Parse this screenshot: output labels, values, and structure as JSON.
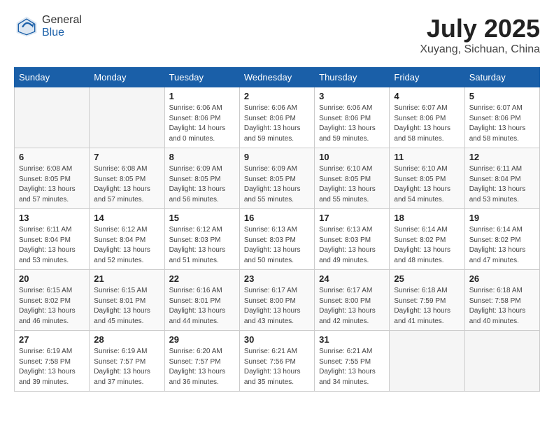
{
  "header": {
    "logo_general": "General",
    "logo_blue": "Blue",
    "month_year": "July 2025",
    "location": "Xuyang, Sichuan, China"
  },
  "days_of_week": [
    "Sunday",
    "Monday",
    "Tuesday",
    "Wednesday",
    "Thursday",
    "Friday",
    "Saturday"
  ],
  "weeks": [
    [
      {
        "day": "",
        "sunrise": "",
        "sunset": "",
        "daylight": "",
        "empty": true
      },
      {
        "day": "",
        "sunrise": "",
        "sunset": "",
        "daylight": "",
        "empty": true
      },
      {
        "day": "1",
        "sunrise": "Sunrise: 6:06 AM",
        "sunset": "Sunset: 8:06 PM",
        "daylight": "Daylight: 14 hours and 0 minutes."
      },
      {
        "day": "2",
        "sunrise": "Sunrise: 6:06 AM",
        "sunset": "Sunset: 8:06 PM",
        "daylight": "Daylight: 13 hours and 59 minutes."
      },
      {
        "day": "3",
        "sunrise": "Sunrise: 6:06 AM",
        "sunset": "Sunset: 8:06 PM",
        "daylight": "Daylight: 13 hours and 59 minutes."
      },
      {
        "day": "4",
        "sunrise": "Sunrise: 6:07 AM",
        "sunset": "Sunset: 8:06 PM",
        "daylight": "Daylight: 13 hours and 58 minutes."
      },
      {
        "day": "5",
        "sunrise": "Sunrise: 6:07 AM",
        "sunset": "Sunset: 8:06 PM",
        "daylight": "Daylight: 13 hours and 58 minutes."
      }
    ],
    [
      {
        "day": "6",
        "sunrise": "Sunrise: 6:08 AM",
        "sunset": "Sunset: 8:05 PM",
        "daylight": "Daylight: 13 hours and 57 minutes."
      },
      {
        "day": "7",
        "sunrise": "Sunrise: 6:08 AM",
        "sunset": "Sunset: 8:05 PM",
        "daylight": "Daylight: 13 hours and 57 minutes."
      },
      {
        "day": "8",
        "sunrise": "Sunrise: 6:09 AM",
        "sunset": "Sunset: 8:05 PM",
        "daylight": "Daylight: 13 hours and 56 minutes."
      },
      {
        "day": "9",
        "sunrise": "Sunrise: 6:09 AM",
        "sunset": "Sunset: 8:05 PM",
        "daylight": "Daylight: 13 hours and 55 minutes."
      },
      {
        "day": "10",
        "sunrise": "Sunrise: 6:10 AM",
        "sunset": "Sunset: 8:05 PM",
        "daylight": "Daylight: 13 hours and 55 minutes."
      },
      {
        "day": "11",
        "sunrise": "Sunrise: 6:10 AM",
        "sunset": "Sunset: 8:05 PM",
        "daylight": "Daylight: 13 hours and 54 minutes."
      },
      {
        "day": "12",
        "sunrise": "Sunrise: 6:11 AM",
        "sunset": "Sunset: 8:04 PM",
        "daylight": "Daylight: 13 hours and 53 minutes."
      }
    ],
    [
      {
        "day": "13",
        "sunrise": "Sunrise: 6:11 AM",
        "sunset": "Sunset: 8:04 PM",
        "daylight": "Daylight: 13 hours and 53 minutes."
      },
      {
        "day": "14",
        "sunrise": "Sunrise: 6:12 AM",
        "sunset": "Sunset: 8:04 PM",
        "daylight": "Daylight: 13 hours and 52 minutes."
      },
      {
        "day": "15",
        "sunrise": "Sunrise: 6:12 AM",
        "sunset": "Sunset: 8:03 PM",
        "daylight": "Daylight: 13 hours and 51 minutes."
      },
      {
        "day": "16",
        "sunrise": "Sunrise: 6:13 AM",
        "sunset": "Sunset: 8:03 PM",
        "daylight": "Daylight: 13 hours and 50 minutes."
      },
      {
        "day": "17",
        "sunrise": "Sunrise: 6:13 AM",
        "sunset": "Sunset: 8:03 PM",
        "daylight": "Daylight: 13 hours and 49 minutes."
      },
      {
        "day": "18",
        "sunrise": "Sunrise: 6:14 AM",
        "sunset": "Sunset: 8:02 PM",
        "daylight": "Daylight: 13 hours and 48 minutes."
      },
      {
        "day": "19",
        "sunrise": "Sunrise: 6:14 AM",
        "sunset": "Sunset: 8:02 PM",
        "daylight": "Daylight: 13 hours and 47 minutes."
      }
    ],
    [
      {
        "day": "20",
        "sunrise": "Sunrise: 6:15 AM",
        "sunset": "Sunset: 8:02 PM",
        "daylight": "Daylight: 13 hours and 46 minutes."
      },
      {
        "day": "21",
        "sunrise": "Sunrise: 6:15 AM",
        "sunset": "Sunset: 8:01 PM",
        "daylight": "Daylight: 13 hours and 45 minutes."
      },
      {
        "day": "22",
        "sunrise": "Sunrise: 6:16 AM",
        "sunset": "Sunset: 8:01 PM",
        "daylight": "Daylight: 13 hours and 44 minutes."
      },
      {
        "day": "23",
        "sunrise": "Sunrise: 6:17 AM",
        "sunset": "Sunset: 8:00 PM",
        "daylight": "Daylight: 13 hours and 43 minutes."
      },
      {
        "day": "24",
        "sunrise": "Sunrise: 6:17 AM",
        "sunset": "Sunset: 8:00 PM",
        "daylight": "Daylight: 13 hours and 42 minutes."
      },
      {
        "day": "25",
        "sunrise": "Sunrise: 6:18 AM",
        "sunset": "Sunset: 7:59 PM",
        "daylight": "Daylight: 13 hours and 41 minutes."
      },
      {
        "day": "26",
        "sunrise": "Sunrise: 6:18 AM",
        "sunset": "Sunset: 7:58 PM",
        "daylight": "Daylight: 13 hours and 40 minutes."
      }
    ],
    [
      {
        "day": "27",
        "sunrise": "Sunrise: 6:19 AM",
        "sunset": "Sunset: 7:58 PM",
        "daylight": "Daylight: 13 hours and 39 minutes."
      },
      {
        "day": "28",
        "sunrise": "Sunrise: 6:19 AM",
        "sunset": "Sunset: 7:57 PM",
        "daylight": "Daylight: 13 hours and 37 minutes."
      },
      {
        "day": "29",
        "sunrise": "Sunrise: 6:20 AM",
        "sunset": "Sunset: 7:57 PM",
        "daylight": "Daylight: 13 hours and 36 minutes."
      },
      {
        "day": "30",
        "sunrise": "Sunrise: 6:21 AM",
        "sunset": "Sunset: 7:56 PM",
        "daylight": "Daylight: 13 hours and 35 minutes."
      },
      {
        "day": "31",
        "sunrise": "Sunrise: 6:21 AM",
        "sunset": "Sunset: 7:55 PM",
        "daylight": "Daylight: 13 hours and 34 minutes."
      },
      {
        "day": "",
        "sunrise": "",
        "sunset": "",
        "daylight": "",
        "empty": true
      },
      {
        "day": "",
        "sunrise": "",
        "sunset": "",
        "daylight": "",
        "empty": true
      }
    ]
  ]
}
